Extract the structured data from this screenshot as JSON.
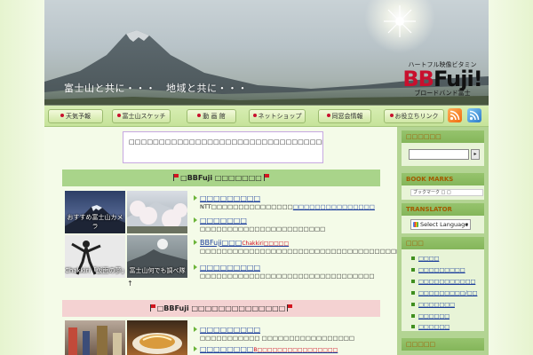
{
  "header": {
    "tagline": "富士山と共に・・・　地域と共に・・・",
    "logo_sub": "ハートフル映像ビタミン",
    "logo_bb": "BB",
    "logo_fuji": "Fuji!",
    "logo_tag": "ブロードバンド富士"
  },
  "nav": {
    "items": [
      "天気予報",
      "富士山スケッチ",
      "動 画 館",
      "ネットショップ",
      "同窓会情報",
      "お役立ちリンク"
    ]
  },
  "notice": {
    "text": "□□□□□□□□□□□□□□□□□□□□□□□□□□□□□□□□□□□□□□□□□□□□□□□□□□□□□□□□□□□□□□□□□□□□□□"
  },
  "section1": {
    "title": "□BBFuji □□□□□□□"
  },
  "section2": {
    "title": "□BBFuji □□□□□□□□□□□□□□"
  },
  "thumbs1": [
    {
      "caption": "おすすめ富士山カメラ"
    },
    {
      "caption": ""
    },
    {
      "caption": "Chakkiri「仮面の夢」"
    },
    {
      "caption": "富士山何でも調べ隊"
    }
  ],
  "list1": [
    {
      "title": "□□□□□□□□□",
      "desc_plain": "NTT□□□□□□□□□□□□□□□",
      "desc_link": "□□□□□□□□□□□□□□□"
    },
    {
      "title": "□□□□□□□",
      "desc_plain": "□□□□□□□□□□□□□□□□□□□□□□□",
      "desc_link": ""
    },
    {
      "title": "BBFuji□□□",
      "badge": "Chakkiri",
      "badge_tail": "□□□□□",
      "desc_plain": "□□□□□□□□□□□□□□□□□□□□□□□□□□□□□□□□□□□□□□□□□□□",
      "desc_link": ""
    },
    {
      "title": "□□□□□□□□□",
      "desc_plain": "□□□□□□□□□□□□□□□□□□□□□□□□□□□□□□□□",
      "desc_link": ""
    }
  ],
  "list2": [
    {
      "title": "□□□□□□□□□",
      "desc_plain": "□□□□□□□□□□□ □□□□□□□□□□□□□□□□□",
      "desc_link": ""
    },
    {
      "title": "□□□□□□□□",
      "badge": "B□□□□□□□□□□□□□□□□",
      "desc_plain": "",
      "desc_link": ""
    }
  ],
  "arrow": "↑",
  "sidebar": {
    "search_head": "□□□□□□",
    "search_btn": "▸",
    "bookmarks_head": "BOOK MARKS",
    "bookmarks_bar": "ブックマーク □ □",
    "translator_head": "TRANSLATOR",
    "language_label": "Select Language",
    "language_arrow": "▾",
    "category_head": "□□□",
    "categories": [
      "□□□□",
      "□□□□□□□□□",
      "□□□□□□□□□□□",
      "□□□□□□□□□/□□",
      "□□□□□□□",
      "□□□□□□",
      "□□□□□□"
    ],
    "bottom_head": "□□□□□"
  },
  "colors": {
    "logo_red": "#c8102e",
    "nav_green": "#c6e39a",
    "section_green": "#a9d48a",
    "section_pink": "#f4d2d2",
    "link_blue": "#1a3c9a",
    "sidebar_green": "#b3d493",
    "sidebar_heading": "#a35a00"
  }
}
